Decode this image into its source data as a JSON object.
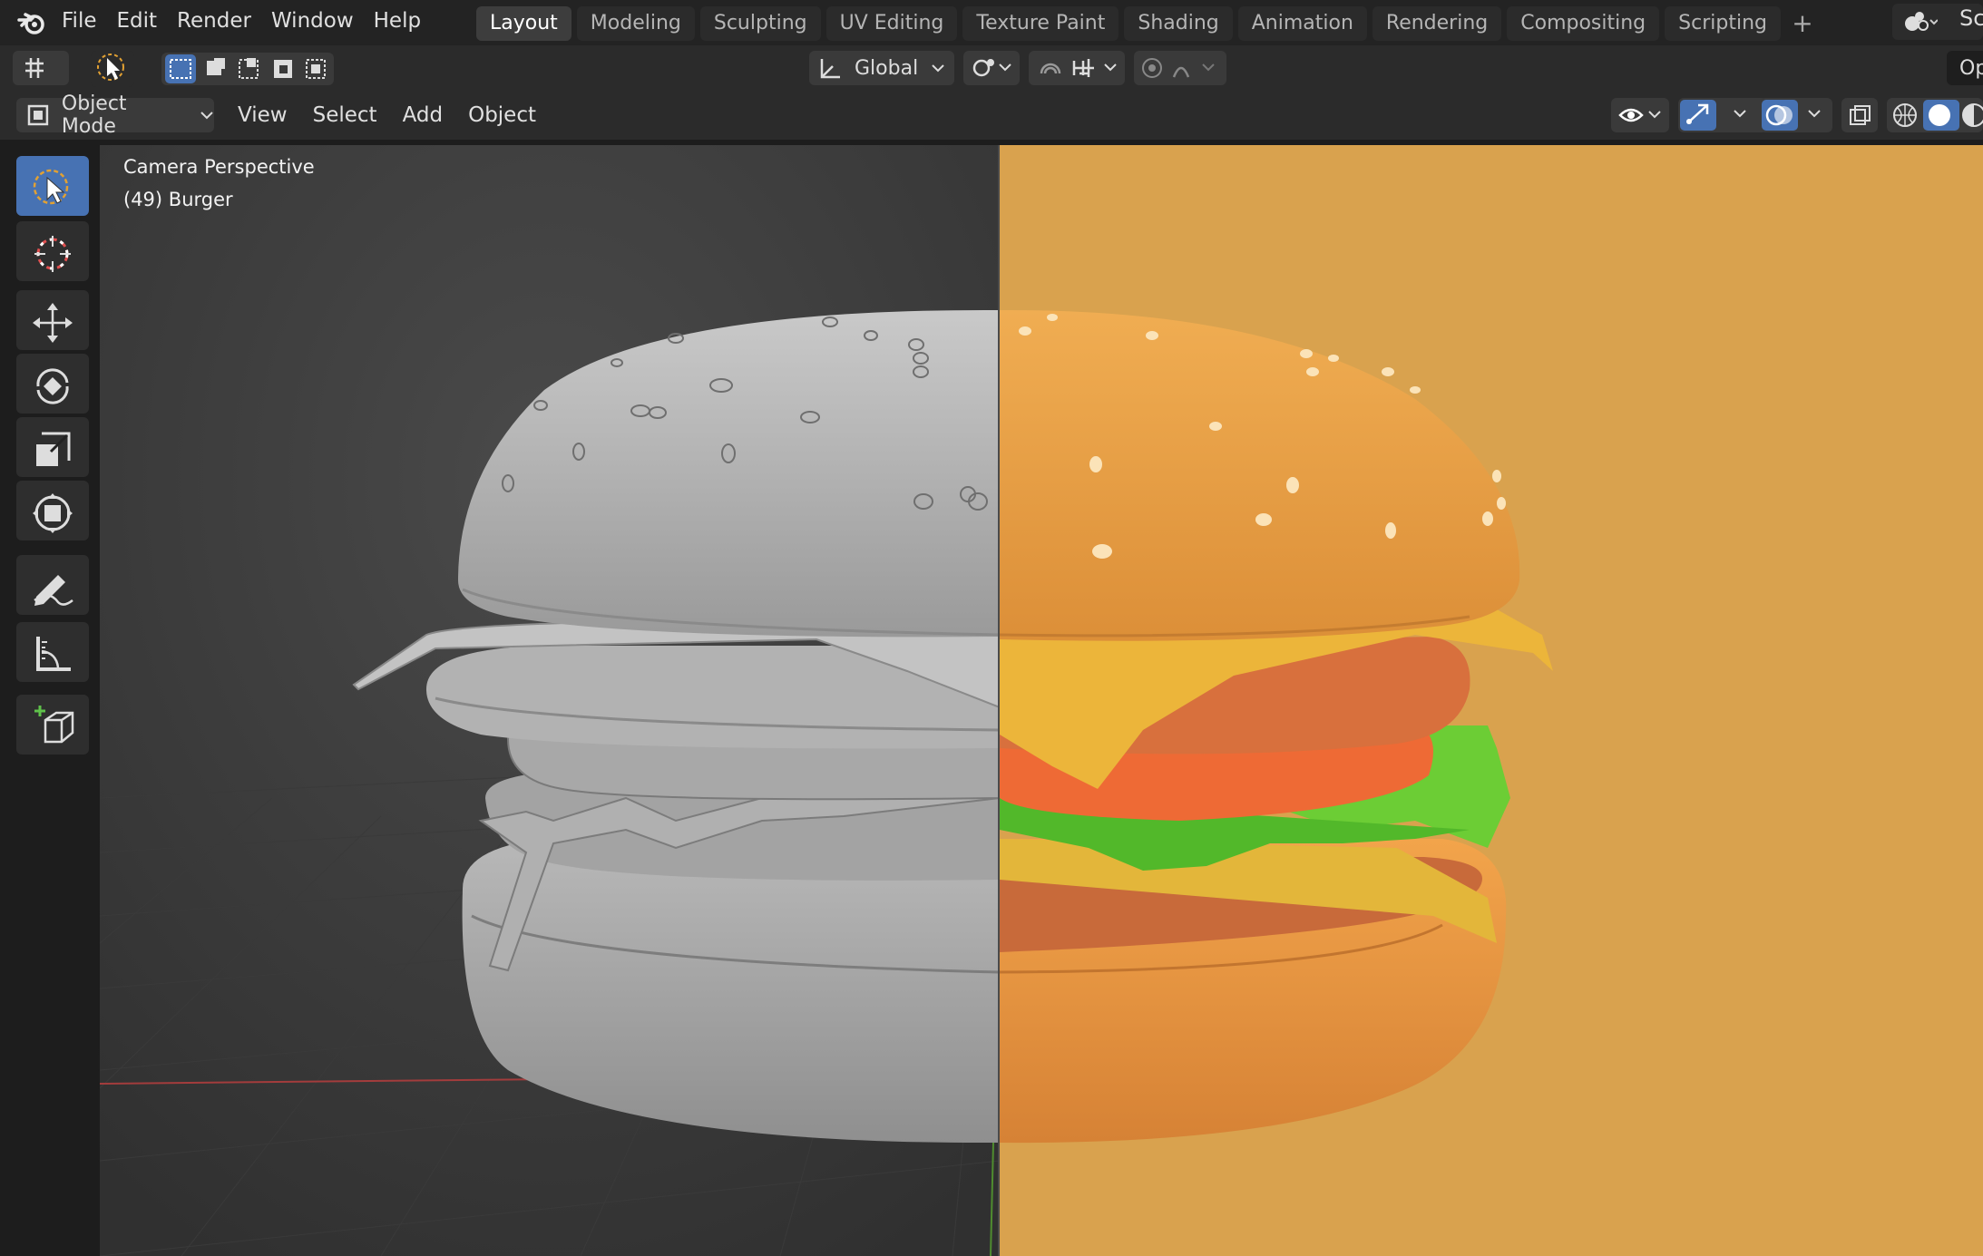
{
  "menu": {
    "items": [
      "File",
      "Edit",
      "Render",
      "Window",
      "Help"
    ]
  },
  "workspaces": {
    "tabs": [
      "Layout",
      "Modeling",
      "Sculpting",
      "UV Editing",
      "Texture Paint",
      "Shading",
      "Animation",
      "Rendering",
      "Compositing",
      "Scripting"
    ],
    "active": "Layout",
    "add_symbol": "+"
  },
  "header_right": {
    "scene_label": "Sc",
    "options_label": "Op"
  },
  "tool_header": {
    "orientation": "Global"
  },
  "viewport_header": {
    "mode": "Object Mode",
    "menus": [
      "View",
      "Select",
      "Add",
      "Object"
    ]
  },
  "viewport": {
    "view_name": "Camera Perspective",
    "active_object": "(49) Burger"
  },
  "colors": {
    "accent": "#4772b3",
    "background": "#d9a24e",
    "bun": "#eaa247",
    "cheese": "#ecb53a",
    "patty": "#d8703d",
    "tomato": "#ee6a35",
    "lettuce": "#6ccd35",
    "clay": "#a8a8a8"
  }
}
